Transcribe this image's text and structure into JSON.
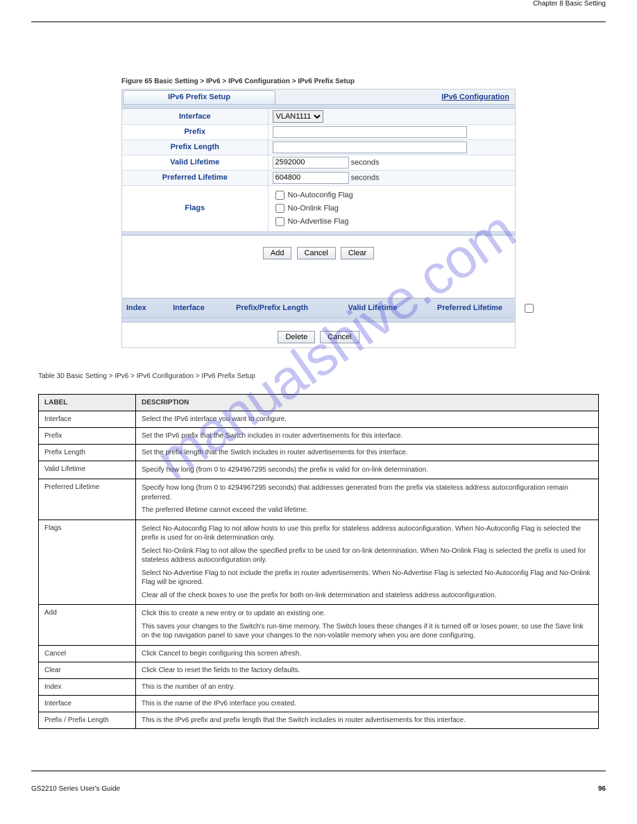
{
  "header": {
    "left": "",
    "chapter": "Chapter 8 Basic Setting"
  },
  "figure_caption": "Figure 65   Basic Setting > IPv6 > IPv6 Configuration > IPv6 Prefix Setup",
  "panel": {
    "tab_title": "IPv6 Prefix Setup",
    "config_link": "IPv6 Configuration",
    "rows": {
      "interface_label": "Interface",
      "interface_value": "VLAN1111",
      "prefix_label": "Prefix",
      "prefix_value": "",
      "prefixlen_label": "Prefix Length",
      "prefixlen_value": "",
      "valid_label": "Valid Lifetime",
      "valid_value": "2592000",
      "valid_unit": "seconds",
      "pref_label": "Preferred Lifetime",
      "pref_value": "604800",
      "pref_unit": "seconds",
      "flags_label": "Flags",
      "flag1": "No-Autoconfig Flag",
      "flag2": "No-Onlink Flag",
      "flag3": "No-Advertise Flag"
    },
    "buttons": {
      "add": "Add",
      "cancel": "Cancel",
      "clear": "Clear",
      "delete": "Delete",
      "cancel2": "Cancel"
    },
    "cols": {
      "c1": "Index",
      "c2": "Interface",
      "c3": "Prefix/Prefix Length",
      "c4": "Valid Lifetime",
      "c5": "Preferred Lifetime"
    }
  },
  "table_caption": "Table 30   Basic Setting > IPv6 > IPv6 Configuration > IPv6 Prefix Setup",
  "desc": {
    "hdr_label": "LABEL",
    "hdr_desc": "DESCRIPTION",
    "interface": {
      "l": "Interface",
      "d": "Select the IPv6 interface you want to configure."
    },
    "prefix": {
      "l": "Prefix",
      "d": "Set the IPv6 prefix that the Switch includes in router advertisements for this interface."
    },
    "prefixlen": {
      "l": "Prefix Length",
      "d": "Set the prefix length that the Switch includes in router advertisements for this interface."
    },
    "valid": {
      "l": "Valid Lifetime",
      "d1": "Specify how long (from 0 to 4294967295 seconds) the prefix is valid for on-link determination.",
      "d2": ""
    },
    "preferred": {
      "l": "Preferred Lifetime",
      "d": "Specify how long (from 0 to 4294967295 seconds) that addresses generated from the prefix via stateless address autoconfiguration remain preferred.",
      "d2": "The preferred lifetime cannot exceed the valid lifetime."
    },
    "flags": {
      "l": "Flags",
      "d1": "Select No-Autoconfig Flag to not allow hosts to use this prefix for stateless address autoconfiguration. When No-Autoconfig Flag is selected the prefix is used for on-link determination only.",
      "d2": "Select No-Onlink Flag to not allow the specified prefix to be used for on-link determination. When No-Onlink Flag is selected the prefix is used for stateless address autoconfiguration only.",
      "d3": "Select No-Advertise Flag to not include the prefix in router advertisements. When No-Advertise Flag is selected No-Autoconfig Flag and No-Onlink Flag will be ignored.",
      "d4": "Clear all of the check boxes to use the prefix for both on-link determination and stateless address autoconfiguration."
    },
    "add": {
      "l": "Add",
      "d": "Click this to create a new entry or to update an existing one.",
      "d2": "This saves your changes to the Switch's run-time memory. The Switch loses these changes if it is turned off or loses power, so use the Save link on the top navigation panel to save your changes to the non-volatile memory when you are done configuring."
    },
    "cancel": {
      "l": "Cancel",
      "d": "Click Cancel to begin configuring this screen afresh."
    },
    "clear": {
      "l": "Clear",
      "d": "Click Clear to reset the fields to the factory defaults."
    },
    "index": {
      "l": "Index",
      "d": "This is the number of an entry."
    },
    "interface2": {
      "l": "Interface",
      "d": "This is the name of the IPv6 interface you created."
    },
    "prefixpl": {
      "l": "Prefix / Prefix Length",
      "d": "This is the IPv6 prefix and prefix length that the Switch includes in router advertisements for this interface."
    }
  },
  "footer": {
    "left": "GS2210 Series User's Guide",
    "page": "96"
  },
  "watermark": "manualshive.com"
}
